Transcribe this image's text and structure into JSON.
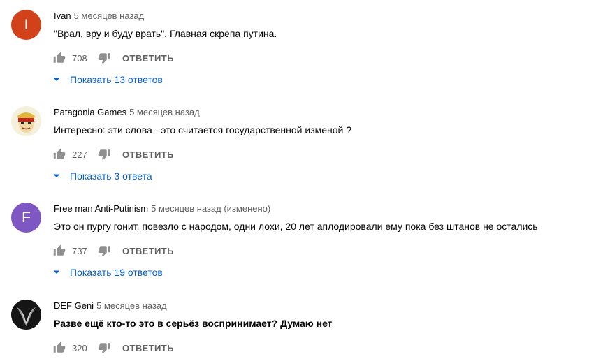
{
  "comments": [
    {
      "author": "Ivan",
      "meta": "5 месяцев назад",
      "text": "\"Врал, вру и буду врать\". Главная скрепа путина.",
      "likes": "708",
      "reply_label": "ОТВЕТИТЬ",
      "replies_label": "Показать 13 ответов",
      "avatar_letter": "I",
      "avatar_color": "#d1421b"
    },
    {
      "author": "Patagonia Games",
      "meta": "5 месяцев назад",
      "text": "Интересно: эти слова - это считается государственной изменой ?",
      "likes": "227",
      "reply_label": "ОТВЕТИТЬ",
      "replies_label": "Показать 3 ответа"
    },
    {
      "author": "Free man Anti-Putinism",
      "meta": "5 месяцев назад (изменено)",
      "text": "Это он пургу гонит, повезло с народом, одни лохи, 20 лет аплодировали ему пока без штанов не остались",
      "likes": "737",
      "reply_label": "ОТВЕТИТЬ",
      "replies_label": "Показать 19 ответов",
      "avatar_letter": "F",
      "avatar_color": "#7e57c2"
    },
    {
      "author": "DEF Geni",
      "meta": "5 месяцев назад",
      "text": "Разве ещё кто-то это в серьёз воспринимает? Думаю нет",
      "likes": "320",
      "reply_label": "ОТВЕТИТЬ"
    }
  ],
  "colors": {
    "link_blue": "#065fd4",
    "secondary_text": "#606060",
    "icon_gray": "#909090"
  }
}
